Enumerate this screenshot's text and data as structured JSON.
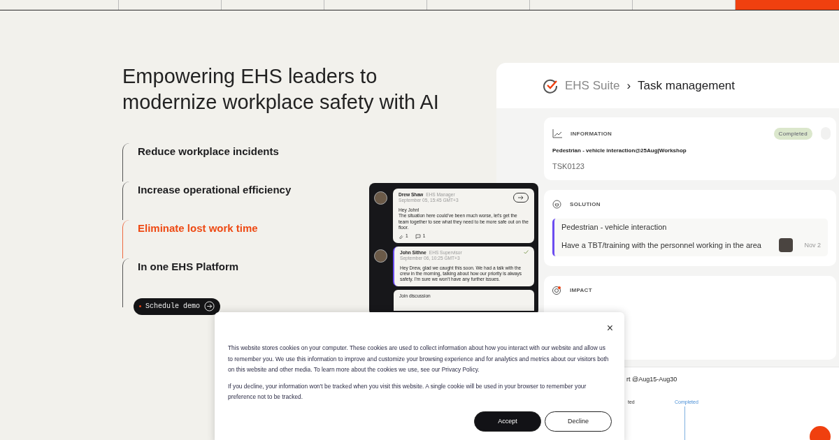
{
  "hero": {
    "headline": "Empowering EHS leaders to modernize workplace safety with AI",
    "benefits": [
      {
        "label": "Reduce workplace incidents",
        "selected": false
      },
      {
        "label": "Increase operational efficiency",
        "selected": false
      },
      {
        "label": "Eliminate lost work time",
        "selected": true
      },
      {
        "label": "In one EHS Platform",
        "selected": false
      }
    ],
    "cta": "Schedule demo"
  },
  "chat": {
    "messages": [
      {
        "author": "Drew Shaw",
        "role": "EHS Manager",
        "time": "September 05, 15:45 GMT+3",
        "greeting": "Hey John!",
        "body": "The situation here could've been much worse, let's get the team together to see what they need to be more safe out on the floor.",
        "attachments": "1",
        "comments": "1",
        "acknowledged": false
      },
      {
        "author": "John Sithne",
        "role": "EHS Supervisor",
        "time": "September 06, 10:25 GMT+3",
        "body": "Hey Drew, glad we caught this soon. We had a talk with the crew in the morning, talking about how our priority is always safety. I'm sure we won't have any further issues.",
        "acknowledged": true
      }
    ],
    "join": "Join discussion"
  },
  "panel": {
    "product": "EHS Suite",
    "separator": "›",
    "page": "Task management",
    "information": {
      "title": "INFORMATION",
      "status": "Completed",
      "task_name": "Pedestrian - vehicle interaction@25Aug|Workshop",
      "task_id": "TSK0123"
    },
    "solution": {
      "title": "SOLUTION",
      "heading": "Pedestrian - vehicle interaction",
      "action": "Have a TBT/training with the personnel working in the area",
      "date": "Nov 2"
    },
    "impact": {
      "title": "IMPACT"
    },
    "timeline": {
      "title": "rt @Aug15-Aug30",
      "status_1": "ted",
      "status_2": "Completed"
    }
  },
  "cookie_dialog": {
    "close": "×",
    "text_1": "This website stores cookies on your computer. These cookies are used to collect information about how you interact with our website and allow us to remember you. We use this information to improve and customize your browsing experience and for analytics and metrics about our visitors both on this website and other media. To learn more about the cookies we use, see our ",
    "link": "Privacy Policy",
    "text_1_end": ".",
    "text_2": "If you decline, your information won't be tracked when you visit this website. A single cookie will be used in your browser to remember your preference not to be tracked.",
    "buttons": [
      "Accept",
      "Decline"
    ]
  }
}
